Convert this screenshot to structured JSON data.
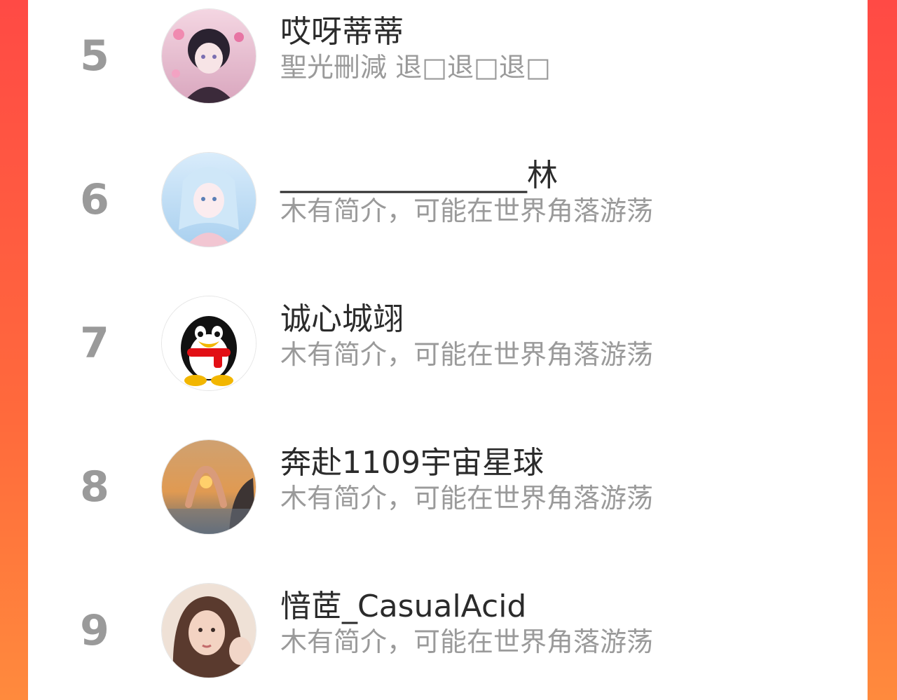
{
  "ranking": {
    "rows": [
      {
        "rank": "5",
        "name": "哎呀蒂蒂",
        "intro": "聖光刪減 退□退□退□",
        "avatar_icon": "anime-girl-avatar-pink"
      },
      {
        "rank": "6",
        "name": "________________林",
        "intro": "木有简介，可能在世界角落游荡",
        "avatar_icon": "anime-girl-avatar-blue"
      },
      {
        "rank": "7",
        "name": "诚心城翊",
        "intro": "木有简介，可能在世界角落游荡",
        "avatar_icon": "qq-penguin-avatar"
      },
      {
        "rank": "8",
        "name": "奔赴1109宇宙星球",
        "intro": "木有简介，可能在世界角落游荡",
        "avatar_icon": "sunset-heart-hands-avatar"
      },
      {
        "rank": "9",
        "name": "愔茝_CasualAcid",
        "intro": "木有简介，可能在世界角落游荡",
        "avatar_icon": "girl-portrait-avatar"
      }
    ]
  },
  "colors": {
    "background_left": "#ff4a45",
    "background_right": "#ff8a3d",
    "rank_gray": "#9a9a9a",
    "name_text": "#2b2b2b",
    "intro_text": "#9a9a9a"
  }
}
